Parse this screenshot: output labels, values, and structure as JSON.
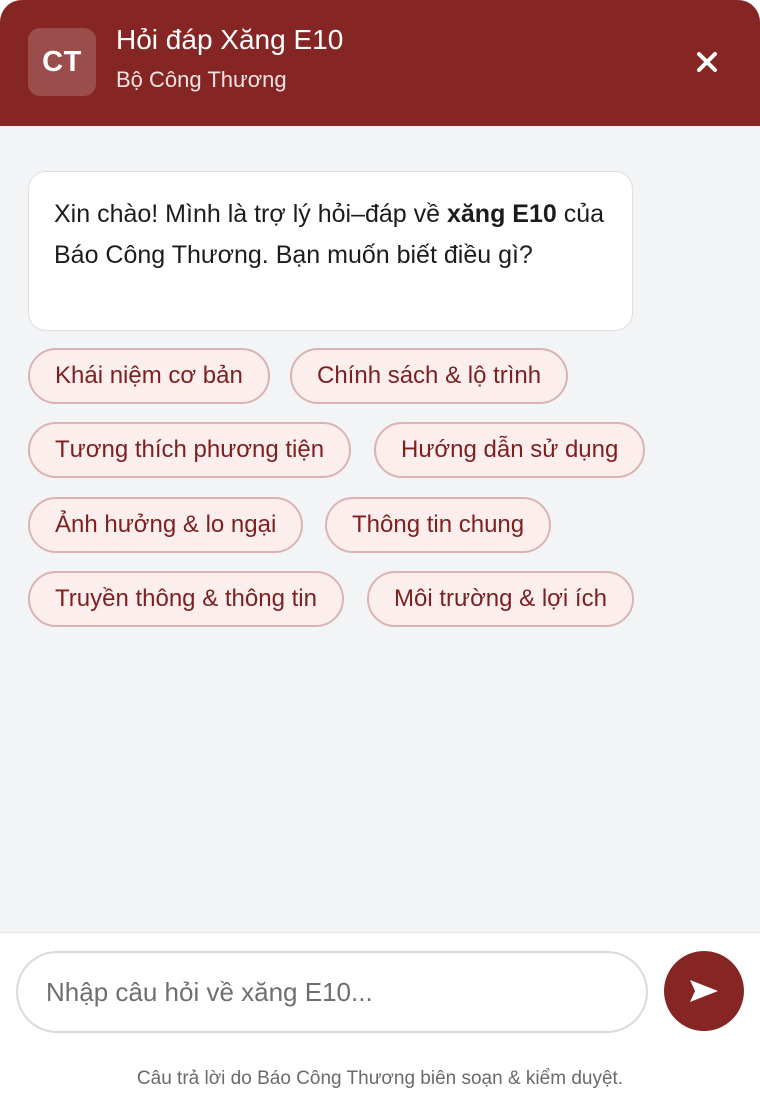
{
  "header": {
    "avatar_text": "CT",
    "title": "Hỏi đáp Xăng E10",
    "subtitle": "Bộ Công Thương",
    "close_icon": "close-icon"
  },
  "welcome": {
    "text_before": "Xin chào! Mình là trợ lý hỏi–đáp về ",
    "bold_text": "xăng E10",
    "text_after": " của Báo Công Thương. Bạn muốn biết điều gì?"
  },
  "suggestions": [
    "Khái niệm cơ bản",
    "Chính sách & lộ trình",
    "Tương thích phương tiện",
    "Hướng dẫn sử dụng",
    "Ảnh hưởng & lo ngại",
    "Thông tin chung",
    "Truyền thông & thông tin",
    "Môi trường & lợi ích"
  ],
  "composer": {
    "placeholder": "Nhập câu hỏi về xăng E10...",
    "send_icon": "send-icon"
  },
  "disclaimer": "Câu trả lời do Báo Công Thương biên soạn & kiểm duyệt.",
  "colors": {
    "brand": "#862624",
    "chip_background": "#fdeeee",
    "chip_border": "#dbb3b3",
    "chip_text": "#7d2020",
    "panel_background": "#f3f4f6"
  }
}
